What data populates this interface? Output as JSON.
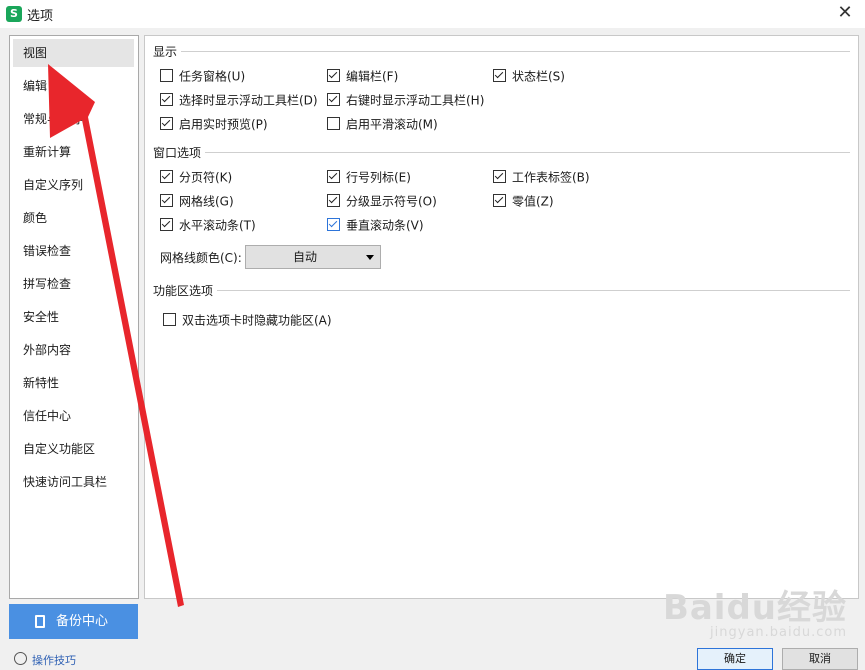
{
  "window": {
    "title": "选项",
    "app_icon_letter": "S",
    "close_glyph": "✕"
  },
  "sidebar": {
    "items": [
      {
        "label": "视图",
        "selected": true
      },
      {
        "label": "编辑"
      },
      {
        "label": "常规与保存"
      },
      {
        "label": "重新计算"
      },
      {
        "label": "自定义序列"
      },
      {
        "label": "颜色"
      },
      {
        "label": "错误检查"
      },
      {
        "label": "拼写检查"
      },
      {
        "label": "安全性"
      },
      {
        "label": "外部内容"
      },
      {
        "label": "新特性"
      },
      {
        "label": "信任中心"
      },
      {
        "label": "自定义功能区"
      },
      {
        "label": "快速访问工具栏"
      }
    ]
  },
  "display": {
    "title": "显示",
    "options": [
      {
        "label": "任务窗格(U)",
        "checked": false
      },
      {
        "label": "编辑栏(F)",
        "checked": true
      },
      {
        "label": "状态栏(S)",
        "checked": true
      },
      {
        "label": "选择时显示浮动工具栏(D)",
        "checked": true
      },
      {
        "label": "右键时显示浮动工具栏(H)",
        "checked": true
      },
      {
        "label": "启用实时预览(P)",
        "checked": true
      },
      {
        "label": "启用平滑滚动(M)",
        "checked": false
      }
    ]
  },
  "window_options": {
    "title": "窗口选项",
    "options": [
      {
        "label": "分页符(K)",
        "checked": true
      },
      {
        "label": "行号列标(E)",
        "checked": true
      },
      {
        "label": "工作表标签(B)",
        "checked": true
      },
      {
        "label": "网格线(G)",
        "checked": true
      },
      {
        "label": "分级显示符号(O)",
        "checked": true
      },
      {
        "label": "零值(Z)",
        "checked": true
      },
      {
        "label": "水平滚动条(T)",
        "checked": true
      },
      {
        "label": "垂直滚动条(V)",
        "checked": true
      }
    ],
    "grid_color_label": "网格线颜色(C):",
    "grid_color_value": "自动"
  },
  "ribbon": {
    "title": "功能区选项",
    "options": [
      {
        "label": "双击选项卡时隐藏功能区(A)",
        "checked": false
      }
    ]
  },
  "footer": {
    "backup_label": "备份中心",
    "link_label": "操作技巧",
    "ok_label": "确定",
    "cancel_label": "取消"
  },
  "watermark": {
    "main": "Baidu经验",
    "sub": "jingyan.baidu.com"
  },
  "colors": {
    "accent": "#4a90e2",
    "arrow": "#e8262c",
    "checkbox_blue": "#2d74d9"
  }
}
